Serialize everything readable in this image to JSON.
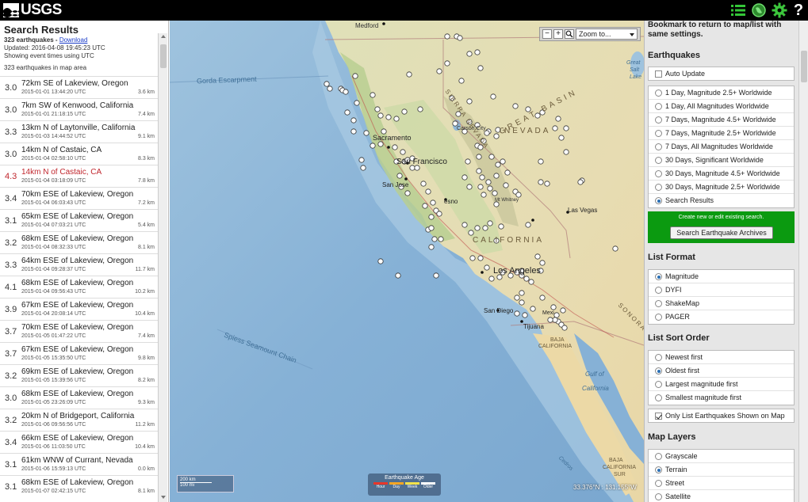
{
  "header": {
    "logo_text": "USGS",
    "icons": [
      "list-icon",
      "globe-icon",
      "settings-gear-icon",
      "help-icon"
    ]
  },
  "list": {
    "title": "Search Results",
    "count_text": "323 earthquakes - ",
    "download_label": "Download",
    "updated": "Updated: 2016-04-08 19:45:23 UTC",
    "timezone_note": "Showing event times using UTC",
    "in_map": "323 earthquakes in map area",
    "items": [
      {
        "mag": "3.0",
        "place": "72km SE of Lakeview, Oregon",
        "time": "2015-01-01 13:44:20 UTC",
        "depth": "3.6 km"
      },
      {
        "mag": "3.0",
        "place": "7km SW of Kenwood, California",
        "time": "2015-01-01 21:18:15 UTC",
        "depth": "7.4 km"
      },
      {
        "mag": "3.3",
        "place": "13km N of Laytonville, California",
        "time": "2015-01-03 14:44:52 UTC",
        "depth": "9.1 km"
      },
      {
        "mag": "3.0",
        "place": "14km N of Castaic, CA",
        "time": "2015-01-04 02:58:10 UTC",
        "depth": "8.3 km"
      },
      {
        "mag": "4.3",
        "place": "14km N of Castaic, CA",
        "time": "2015-01-04 03:18:09 UTC",
        "depth": "7.8 km",
        "selected": true
      },
      {
        "mag": "3.4",
        "place": "70km ESE of Lakeview, Oregon",
        "time": "2015-01-04 06:03:43 UTC",
        "depth": "7.2 km"
      },
      {
        "mag": "3.1",
        "place": "65km ESE of Lakeview, Oregon",
        "time": "2015-01-04 07:03:21 UTC",
        "depth": "5.4 km"
      },
      {
        "mag": "3.2",
        "place": "68km ESE of Lakeview, Oregon",
        "time": "2015-01-04 08:32:33 UTC",
        "depth": "8.1 km"
      },
      {
        "mag": "3.3",
        "place": "64km ESE of Lakeview, Oregon",
        "time": "2015-01-04 09:28:37 UTC",
        "depth": "11.7 km"
      },
      {
        "mag": "4.1",
        "place": "68km ESE of Lakeview, Oregon",
        "time": "2015-01-04 09:56:43 UTC",
        "depth": "10.2 km"
      },
      {
        "mag": "3.9",
        "place": "67km ESE of Lakeview, Oregon",
        "time": "2015-01-04 20:08:14 UTC",
        "depth": "10.4 km"
      },
      {
        "mag": "3.7",
        "place": "70km ESE of Lakeview, Oregon",
        "time": "2015-01-05 01:47:22 UTC",
        "depth": "7.4 km"
      },
      {
        "mag": "3.7",
        "place": "67km ESE of Lakeview, Oregon",
        "time": "2015-01-05 15:35:50 UTC",
        "depth": "9.8 km"
      },
      {
        "mag": "3.2",
        "place": "69km ESE of Lakeview, Oregon",
        "time": "2015-01-05 15:39:56 UTC",
        "depth": "8.2 km"
      },
      {
        "mag": "3.0",
        "place": "68km ESE of Lakeview, Oregon",
        "time": "2015-01-05 23:26:09 UTC",
        "depth": "9.3 km"
      },
      {
        "mag": "3.2",
        "place": "20km N of Bridgeport, California",
        "time": "2015-01-06 09:56:56 UTC",
        "depth": "11.2 km"
      },
      {
        "mag": "3.4",
        "place": "66km ESE of Lakeview, Oregon",
        "time": "2015-01-06 11:03:50 UTC",
        "depth": "10.4 km"
      },
      {
        "mag": "3.1",
        "place": "61km WNW of Currant, Nevada",
        "time": "2015-01-06 15:59:13 UTC",
        "depth": "0.0 km"
      },
      {
        "mag": "3.1",
        "place": "68km ESE of Lakeview, Oregon",
        "time": "2015-01-07 02:42:15 UTC",
        "depth": "8.1 km"
      }
    ]
  },
  "map": {
    "zoom_in": "+",
    "zoom_out": "−",
    "zoom_select": "Zoom to...",
    "scale_km": "200 km",
    "scale_mi": "100 mi",
    "legend_title": "Earthquake Age",
    "legend_labels": [
      "Hour",
      "Day",
      "Week",
      "Older"
    ],
    "legend_colors": [
      "#e8362a",
      "#f5a623",
      "#f3e24a",
      "#ffffff"
    ],
    "coord": "33.376°N : 131.155°W",
    "labels": {
      "medford": "Medford",
      "gorda": "Gorda Escarpment",
      "sacramento": "Sacramento",
      "san_francisco": "San Francisco",
      "san_jose": "San Jose",
      "fresno": "esno",
      "carson_city": "Carson City",
      "nevada": "NEVADA",
      "great_basin": "GREAT BASIN",
      "california": "CALIFORNIA",
      "las_vegas": "Las Vegas",
      "mt_whitney": "Mt Whitney",
      "los_angeles": "Los Angeles",
      "san_diego": "San Diego",
      "tijuana": "Tijuana",
      "mexicali": "Mexi",
      "baja": "BAJA",
      "baja_cal": "CALIFORNIA",
      "spiess": "Spiess Seamount Chain",
      "gulf": "Gulf of",
      "gulf2": "California",
      "great_salt": "Great",
      "great_salt2": "Salt",
      "great_salt3": "Lake",
      "sonora": "SONORA",
      "baja_sur": "BAJA",
      "baja_sur2": "CALIFORNIA",
      "baja_sur3": "SUR",
      "sierra": "SIERRA NEVADA",
      "cedros": "Cedros"
    }
  },
  "settings": {
    "bookmark_note": "Bookmark to return to map/list with same settings.",
    "earthquakes_title": "Earthquakes",
    "auto_update": "Auto Update",
    "feeds": [
      {
        "label": "1 Day, Magnitude 2.5+ Worldwide",
        "checked": false
      },
      {
        "label": "1 Day, All Magnitudes Worldwide",
        "checked": false
      },
      {
        "label": "7 Days, Magnitude 4.5+ Worldwide",
        "checked": false
      },
      {
        "label": "7 Days, Magnitude 2.5+ Worldwide",
        "checked": false
      },
      {
        "label": "7 Days, All Magnitudes Worldwide",
        "checked": false
      },
      {
        "label": "30 Days, Significant Worldwide",
        "checked": false
      },
      {
        "label": "30 Days, Magnitude 4.5+ Worldwide",
        "checked": false
      },
      {
        "label": "30 Days, Magnitude 2.5+ Worldwide",
        "checked": false
      },
      {
        "label": "Search Results",
        "checked": true
      }
    ],
    "create_text": "Create new or edit existing search.",
    "search_button": "Search Earthquake Archives",
    "list_format_title": "List Format",
    "list_format": [
      {
        "label": "Magnitude",
        "checked": true
      },
      {
        "label": "DYFI",
        "checked": false
      },
      {
        "label": "ShakeMap",
        "checked": false
      },
      {
        "label": "PAGER",
        "checked": false
      }
    ],
    "sort_title": "List Sort Order",
    "sort": [
      {
        "label": "Newest first",
        "checked": false
      },
      {
        "label": "Oldest first",
        "checked": true
      },
      {
        "label": "Largest magnitude first",
        "checked": false
      },
      {
        "label": "Smallest magnitude first",
        "checked": false
      }
    ],
    "only_list": "Only List Earthquakes Shown on Map",
    "layers_title": "Map Layers",
    "layers": [
      {
        "label": "Grayscale",
        "checked": false
      },
      {
        "label": "Terrain",
        "checked": true
      },
      {
        "label": "Street",
        "checked": false
      },
      {
        "label": "Satellite",
        "checked": false
      }
    ]
  }
}
